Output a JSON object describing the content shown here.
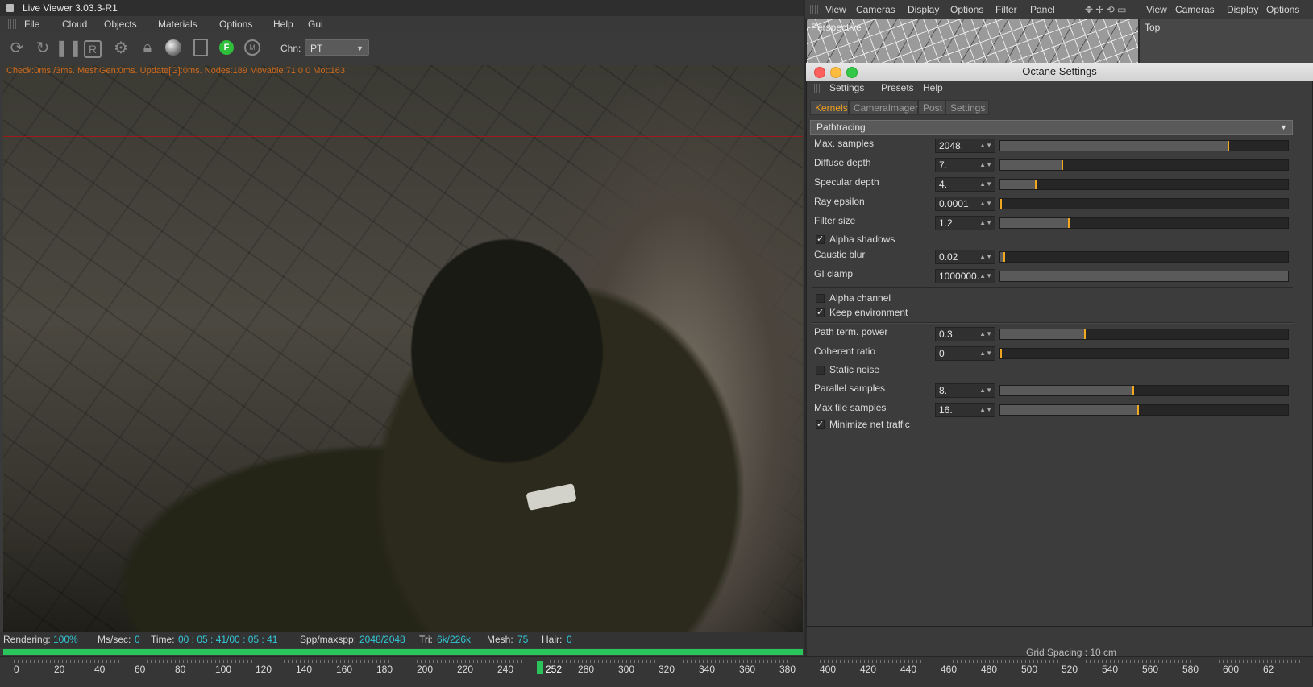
{
  "live_viewer": {
    "title": "Live Viewer 3.03.3-R1",
    "menu": [
      "File",
      "Cloud",
      "Objects",
      "Materials",
      "Options",
      "Help",
      "Gui"
    ],
    "toolbar_icons": [
      "send-scene-icon",
      "restart-icon",
      "pause-icon",
      "region-icon",
      "settings-icon",
      "lock-icon",
      "material-sphere-icon",
      "window-icon",
      "focus-pin-icon",
      "mat-pin-icon"
    ],
    "chn_label": "Chn:",
    "chn_value": "PT",
    "overlay_status": "Check:0ms./3ms. MeshGen:0ms. Update[G]:0ms. Nodes:189 Movable:71  0 0 Mot:163",
    "info": {
      "rendering_label": "Rendering:",
      "rendering_value": "100%",
      "mssec_label": "Ms/sec:",
      "mssec_value": "0",
      "time_label": "Time:",
      "time_value": "00 : 05 : 41/00 : 05 : 41",
      "spp_label": "Spp/maxspp:",
      "spp_value": "2048/2048",
      "tri_label": "Tri:",
      "tri_value": "6k/226k",
      "mesh_label": "Mesh:",
      "mesh_value": "75",
      "hair_label": "Hair:",
      "hair_value": "0"
    },
    "progress": 1.0
  },
  "timeline": {
    "labels": [
      "0",
      "20",
      "40",
      "60",
      "80",
      "100",
      "120",
      "140",
      "160",
      "180",
      "200",
      "220",
      "240",
      "252",
      "280",
      "300",
      "320",
      "340",
      "360",
      "380",
      "400",
      "420",
      "440",
      "460",
      "480",
      "500",
      "520",
      "540",
      "560",
      "580",
      "600",
      "62"
    ],
    "current": "252"
  },
  "viewports": {
    "left_menu": [
      "View",
      "Cameras",
      "Display",
      "Options",
      "Filter",
      "Panel"
    ],
    "right_menu": [
      "View",
      "Cameras",
      "Display",
      "Options"
    ],
    "perspective_label": "Perspective",
    "top_label": "Top",
    "grid_spacing": "Grid Spacing : 10 cm"
  },
  "octane": {
    "title": "Octane Settings",
    "menu": [
      "Settings",
      "Presets",
      "Help"
    ],
    "tabs": [
      "Kernels",
      "CameraImager",
      "Post",
      "Settings"
    ],
    "kernel": "Pathtracing",
    "params": [
      {
        "label": "Max. samples",
        "value": "2048.",
        "fraction": 0.796
      },
      {
        "label": "Diffuse depth",
        "value": "7.",
        "fraction": 0.215
      },
      {
        "label": "Specular depth",
        "value": "4.",
        "fraction": 0.122
      },
      {
        "label": "Ray epsilon",
        "value": "0.0001",
        "fraction": 0.0
      },
      {
        "label": "Filter size",
        "value": "1.2",
        "fraction": 0.236
      }
    ],
    "alpha_shadows": {
      "label": "Alpha shadows",
      "checked": true
    },
    "params2": [
      {
        "label": "Caustic blur",
        "value": "0.02",
        "fraction": 0.01
      },
      {
        "label": "GI clamp",
        "value": "1000000.",
        "fraction": 1.0
      }
    ],
    "alpha_channel": {
      "label": "Alpha channel",
      "checked": false
    },
    "keep_environment": {
      "label": "Keep environment",
      "checked": true
    },
    "params3": [
      {
        "label": "Path term. power",
        "value": "0.3",
        "fraction": 0.295
      },
      {
        "label": "Coherent ratio",
        "value": "0",
        "fraction": 0.0
      }
    ],
    "static_noise": {
      "label": "Static noise",
      "checked": false
    },
    "params4": [
      {
        "label": "Parallel samples",
        "value": "8.",
        "fraction": 0.464
      },
      {
        "label": "Max tile samples",
        "value": "16.",
        "fraction": 0.48
      }
    ],
    "minimize_net": {
      "label": "Minimize net traffic",
      "checked": true
    },
    "accent": "#f0a820"
  }
}
